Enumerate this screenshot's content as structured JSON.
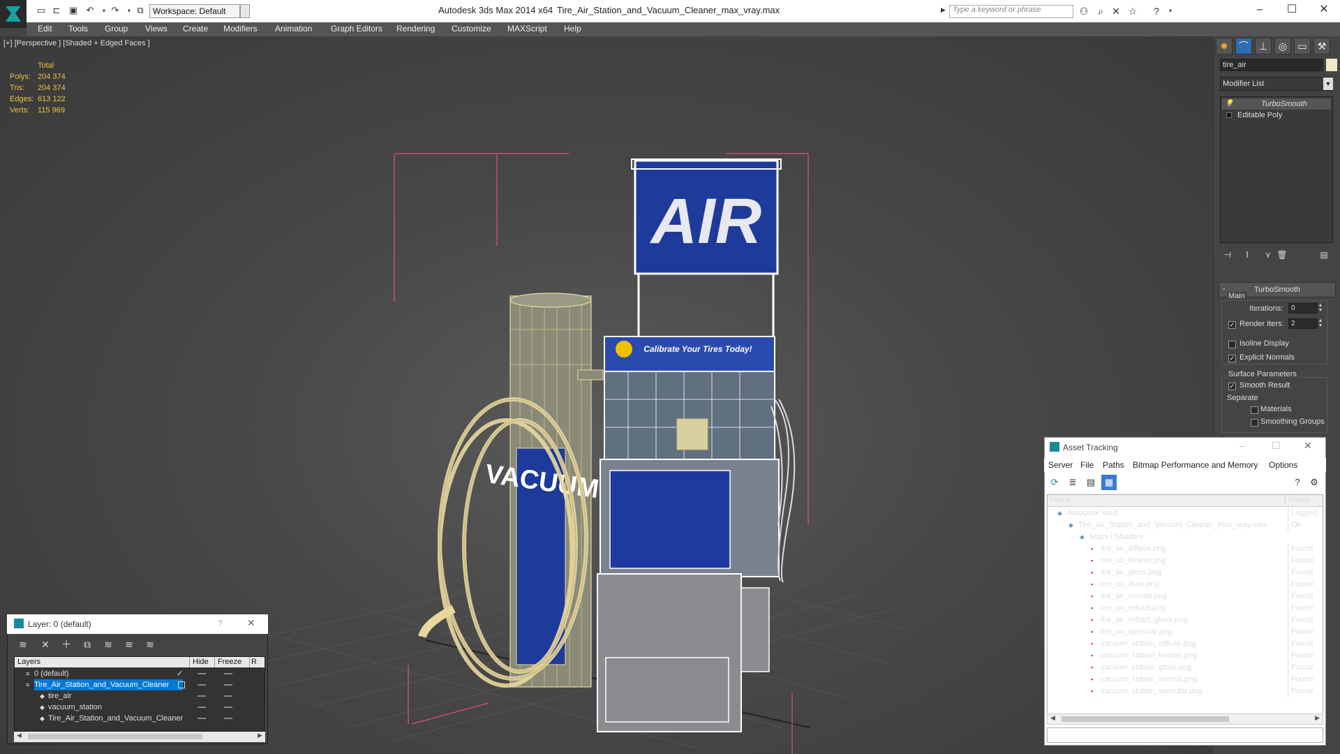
{
  "titlebar": {
    "workspace": "Workspace: Default",
    "app": "Autodesk 3ds Max  2014 x64",
    "file": "Tire_Air_Station_and_Vacuum_Cleaner_max_vray.max",
    "search_placeholder": "Type a keyword or phrase"
  },
  "menu": [
    "Edit",
    "Tools",
    "Group",
    "Views",
    "Create",
    "Modifiers",
    "Animation",
    "Graph Editors",
    "Rendering",
    "Customize",
    "MAXScript",
    "Help"
  ],
  "viewport": {
    "label": "[+] [Perspective ] [Shaded + Edged Faces ]",
    "stats": {
      "header": "Total",
      "rows": [
        {
          "k": "Polys:",
          "v": "204 374"
        },
        {
          "k": "Tris:",
          "v": "204 374"
        },
        {
          "k": "Edges:",
          "v": "613 122"
        },
        {
          "k": "Verts:",
          "v": "115 969"
        }
      ]
    },
    "sign_text": "AIR",
    "vacuum_text": "VACUUM",
    "banner_text": "Calibrate Your Tires Today!"
  },
  "command_panel": {
    "object_name": "tire_air",
    "modifier_list": "Modifier List",
    "stack": [
      "TurboSmooth",
      "Editable Poly"
    ],
    "rollout": "TurboSmooth",
    "main": "Main",
    "iterations_label": "Iterations:",
    "iterations": "0",
    "render_iters_label": "Render Iters:",
    "render_iters": "2",
    "isoline": "Isoline Display",
    "explicit_normals": "Explicit Normals",
    "surface_params": "Surface Parameters",
    "smooth_result": "Smooth Result",
    "separate": "Separate",
    "materials": "Materials",
    "smoothing_groups": "Smoothing Groups"
  },
  "asset_tracking": {
    "title": "Asset Tracking",
    "menu": [
      "Server",
      "File",
      "Paths",
      "Bitmap Performance and Memory",
      "Options"
    ],
    "col_name": "Name",
    "col_status": "Status",
    "rows": [
      {
        "name": "Autodesk Vault",
        "status": "Logged O",
        "indent": 0
      },
      {
        "name": "Tire_Air_Station_and_Vacuum_Cleaner_max_vray.max",
        "status": "Ok",
        "indent": 1
      },
      {
        "name": "Maps / Shaders",
        "status": "",
        "indent": 2
      },
      {
        "name": "tire_air_diffuse.png",
        "status": "Found",
        "indent": 3
      },
      {
        "name": "tire_air_fresnel.png",
        "status": "Found",
        "indent": 3
      },
      {
        "name": "tire_air_gloss.png",
        "status": "Found",
        "indent": 3
      },
      {
        "name": "tire_air_illum.png",
        "status": "Found",
        "indent": 3
      },
      {
        "name": "tire_air_normal.png",
        "status": "Found",
        "indent": 3
      },
      {
        "name": "tire_air_refract.png",
        "status": "Found",
        "indent": 3
      },
      {
        "name": "tire_air_refract_gloss.png",
        "status": "Found",
        "indent": 3
      },
      {
        "name": "tire_air_specular.png",
        "status": "Found",
        "indent": 3
      },
      {
        "name": "vacuum_station_diffuse.png",
        "status": "Found",
        "indent": 3
      },
      {
        "name": "vacuum_station_fresnel.png",
        "status": "Found",
        "indent": 3
      },
      {
        "name": "vacuum_station_gloss.png",
        "status": "Found",
        "indent": 3
      },
      {
        "name": "vacuum_station_normal.png",
        "status": "Found",
        "indent": 3
      },
      {
        "name": "vacuum_station_specular.png",
        "status": "Found",
        "indent": 3
      }
    ]
  },
  "layer": {
    "title": "Layer: 0 (default)",
    "help": "?",
    "col_layers": "Layers",
    "col_hide": "Hide",
    "col_freeze": "Freeze",
    "col_r": "R",
    "rows": [
      {
        "name": "0 (default)",
        "indent": 0,
        "selected": false
      },
      {
        "name": "Tire_Air_Station_and_Vacuum_Cleaner",
        "indent": 0,
        "selected": true
      },
      {
        "name": "tire_air",
        "indent": 1,
        "selected": false
      },
      {
        "name": "vacuum_station",
        "indent": 1,
        "selected": false
      },
      {
        "name": "Tire_Air_Station_and_Vacuum_Cleaner",
        "indent": 1,
        "selected": false
      }
    ]
  },
  "colors": {
    "accent": "#0078d7",
    "stats": "#f0c040",
    "wire": "#e8d8a0",
    "select": "#ffffff",
    "bbox": "#e05080"
  }
}
